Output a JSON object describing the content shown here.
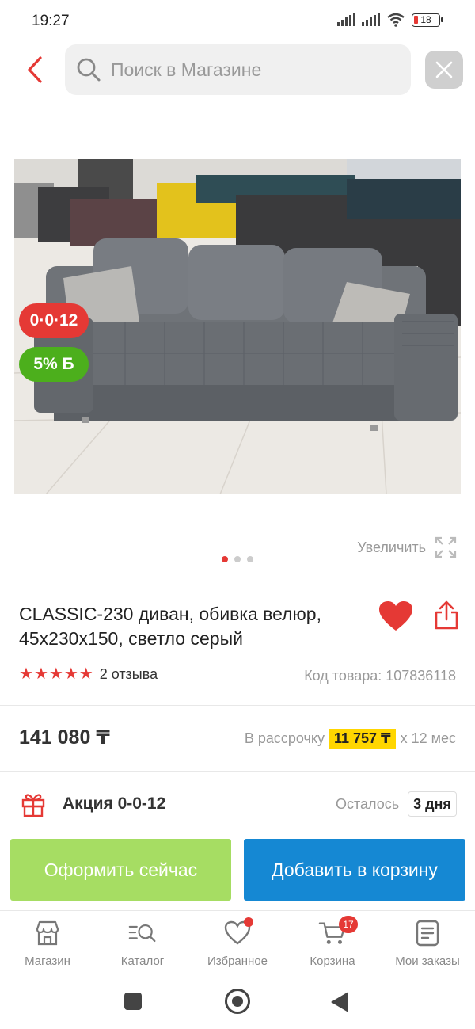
{
  "status_bar": {
    "time": "19:27",
    "battery": "18"
  },
  "search": {
    "placeholder": "Поиск в Магазине"
  },
  "badges": {
    "installment_badge": "0·0·12",
    "bonus_badge": "5% Б"
  },
  "gallery": {
    "zoom_label": "Увеличить",
    "dot_count": 3,
    "active_dot": 0
  },
  "product": {
    "title": "CLASSIC-230 диван, обивка велюр, 45х230х150, светло серый",
    "rating_stars": 5,
    "reviews": "2 отзыва",
    "sku": "Код товара: 107836118",
    "price": "141 080 ₸",
    "installment_prefix": "В рассрочку",
    "installment_amount": "11 757 ₸",
    "installment_suffix": "х 12 мес"
  },
  "promo": {
    "label": "Акция 0-0-12",
    "left_label": "Осталось",
    "days": "3 дня"
  },
  "actions": {
    "buy_now": "Оформить сейчас",
    "add_to_cart": "Добавить в корзину"
  },
  "tabbar": {
    "items": [
      {
        "label": "Магазин",
        "icon": "shop-icon"
      },
      {
        "label": "Каталог",
        "icon": "catalog-search-icon"
      },
      {
        "label": "Избранное",
        "icon": "heart-icon"
      },
      {
        "label": "Корзина",
        "icon": "cart-icon",
        "badge": "17"
      },
      {
        "label": "Мои заказы",
        "icon": "orders-icon"
      }
    ]
  },
  "colors": {
    "accent_red": "#e53935",
    "buy_green": "#a6dd63",
    "cart_blue": "#1588d3",
    "installment_yellow": "#ffd600",
    "bonus_green": "#4caf1c"
  }
}
